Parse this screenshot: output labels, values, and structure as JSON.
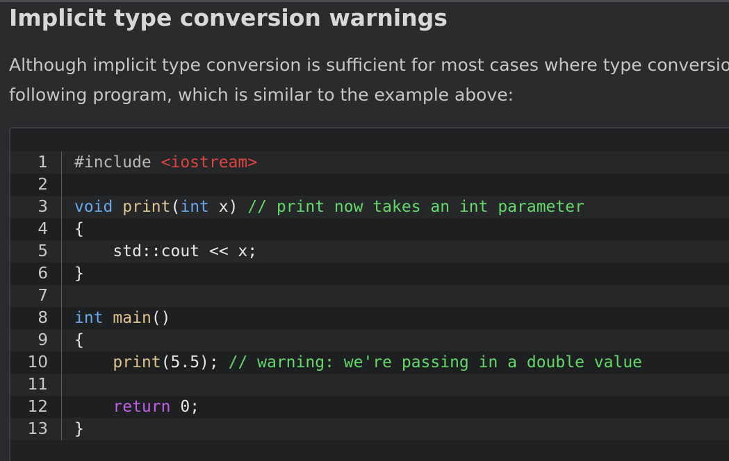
{
  "article": {
    "heading": "Implicit type conversion warnings",
    "paragraph_lines": [
      "Although implicit type conversion is sufficient for most cases where type conversion",
      "following program, which is similar to the example above:"
    ]
  },
  "code_block": {
    "language": "cpp",
    "lines": [
      {
        "number": "1",
        "tokens": [
          {
            "type": "pre",
            "text": "#include "
          },
          {
            "type": "str",
            "text": "<iostream>"
          }
        ]
      },
      {
        "number": "2",
        "tokens": []
      },
      {
        "number": "3",
        "tokens": [
          {
            "type": "kw",
            "text": "void"
          },
          {
            "type": "plain",
            "text": " "
          },
          {
            "type": "fn",
            "text": "print"
          },
          {
            "type": "plain",
            "text": "("
          },
          {
            "type": "kw",
            "text": "int"
          },
          {
            "type": "plain",
            "text": " x) "
          },
          {
            "type": "cm",
            "text": "// print now takes an int parameter"
          }
        ]
      },
      {
        "number": "4",
        "tokens": [
          {
            "type": "plain",
            "text": "{"
          }
        ]
      },
      {
        "number": "5",
        "tokens": [
          {
            "type": "plain",
            "text": "    std::cout << x;"
          }
        ]
      },
      {
        "number": "6",
        "tokens": [
          {
            "type": "plain",
            "text": "}"
          }
        ]
      },
      {
        "number": "7",
        "tokens": []
      },
      {
        "number": "8",
        "tokens": [
          {
            "type": "kw",
            "text": "int"
          },
          {
            "type": "plain",
            "text": " "
          },
          {
            "type": "fn",
            "text": "main"
          },
          {
            "type": "plain",
            "text": "()"
          }
        ]
      },
      {
        "number": "9",
        "tokens": [
          {
            "type": "plain",
            "text": "{"
          }
        ]
      },
      {
        "number": "10",
        "tokens": [
          {
            "type": "plain",
            "text": "    "
          },
          {
            "type": "fn",
            "text": "print"
          },
          {
            "type": "plain",
            "text": "("
          },
          {
            "type": "num",
            "text": "5.5"
          },
          {
            "type": "plain",
            "text": "); "
          },
          {
            "type": "cm",
            "text": "// warning: we're passing in a double value"
          }
        ]
      },
      {
        "number": "11",
        "tokens": []
      },
      {
        "number": "12",
        "tokens": [
          {
            "type": "plain",
            "text": "    "
          },
          {
            "type": "ret",
            "text": "return"
          },
          {
            "type": "plain",
            "text": " "
          },
          {
            "type": "num",
            "text": "0"
          },
          {
            "type": "plain",
            "text": ";"
          }
        ]
      },
      {
        "number": "13",
        "tokens": [
          {
            "type": "plain",
            "text": "}"
          }
        ]
      }
    ]
  },
  "colors": {
    "background": "#2a2b2d",
    "code_background": "#202122",
    "keyword": "#6aa6ec",
    "function": "#dfc38f",
    "comment": "#63d96a",
    "string": "#e0433f",
    "return_keyword": "#c060ea"
  }
}
